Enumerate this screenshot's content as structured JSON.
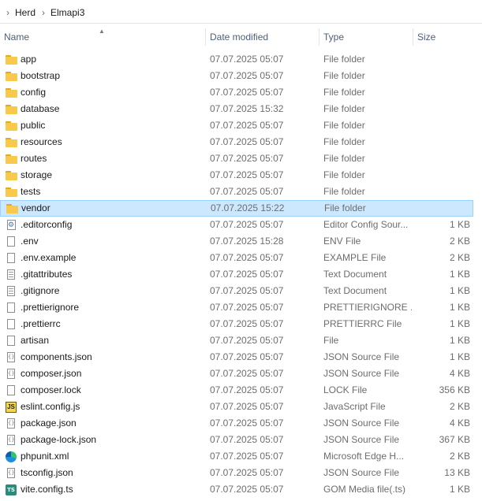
{
  "breadcrumb": {
    "segments": [
      "Herd",
      "Elmapi3"
    ]
  },
  "columns": {
    "name": "Name",
    "date": "Date modified",
    "type": "Type",
    "size": "Size"
  },
  "files": [
    {
      "name": "app",
      "date": "07.07.2025 05:07",
      "type": "File folder",
      "size": "",
      "icon": "folder-icon"
    },
    {
      "name": "bootstrap",
      "date": "07.07.2025 05:07",
      "type": "File folder",
      "size": "",
      "icon": "folder-icon"
    },
    {
      "name": "config",
      "date": "07.07.2025 05:07",
      "type": "File folder",
      "size": "",
      "icon": "folder-icon"
    },
    {
      "name": "database",
      "date": "07.07.2025 15:32",
      "type": "File folder",
      "size": "",
      "icon": "folder-icon"
    },
    {
      "name": "public",
      "date": "07.07.2025 05:07",
      "type": "File folder",
      "size": "",
      "icon": "folder-icon"
    },
    {
      "name": "resources",
      "date": "07.07.2025 05:07",
      "type": "File folder",
      "size": "",
      "icon": "folder-icon"
    },
    {
      "name": "routes",
      "date": "07.07.2025 05:07",
      "type": "File folder",
      "size": "",
      "icon": "folder-icon"
    },
    {
      "name": "storage",
      "date": "07.07.2025 05:07",
      "type": "File folder",
      "size": "",
      "icon": "folder-icon"
    },
    {
      "name": "tests",
      "date": "07.07.2025 05:07",
      "type": "File folder",
      "size": "",
      "icon": "folder-icon"
    },
    {
      "name": "vendor",
      "date": "07.07.2025 15:22",
      "type": "File folder",
      "size": "",
      "icon": "folder-icon",
      "selected": true
    },
    {
      "name": ".editorconfig",
      "date": "07.07.2025 05:07",
      "type": "Editor Config Sour...",
      "size": "1 KB",
      "icon": "gear-file-icon"
    },
    {
      "name": ".env",
      "date": "07.07.2025 15:28",
      "type": "ENV File",
      "size": "2 KB",
      "icon": "file-icon"
    },
    {
      "name": ".env.example",
      "date": "07.07.2025 05:07",
      "type": "EXAMPLE File",
      "size": "2 KB",
      "icon": "file-icon"
    },
    {
      "name": ".gitattributes",
      "date": "07.07.2025 05:07",
      "type": "Text Document",
      "size": "1 KB",
      "icon": "text-file-icon"
    },
    {
      "name": ".gitignore",
      "date": "07.07.2025 05:07",
      "type": "Text Document",
      "size": "1 KB",
      "icon": "text-file-icon"
    },
    {
      "name": ".prettierignore",
      "date": "07.07.2025 05:07",
      "type": "PRETTIERIGNORE ...",
      "size": "1 KB",
      "icon": "file-icon"
    },
    {
      "name": ".prettierrc",
      "date": "07.07.2025 05:07",
      "type": "PRETTIERRC File",
      "size": "1 KB",
      "icon": "file-icon"
    },
    {
      "name": "artisan",
      "date": "07.07.2025 05:07",
      "type": "File",
      "size": "1 KB",
      "icon": "file-icon"
    },
    {
      "name": "components.json",
      "date": "07.07.2025 05:07",
      "type": "JSON Source File",
      "size": "1 KB",
      "icon": "json-file-icon"
    },
    {
      "name": "composer.json",
      "date": "07.07.2025 05:07",
      "type": "JSON Source File",
      "size": "4 KB",
      "icon": "json-file-icon"
    },
    {
      "name": "composer.lock",
      "date": "07.07.2025 05:07",
      "type": "LOCK File",
      "size": "356 KB",
      "icon": "file-icon"
    },
    {
      "name": "eslint.config.js",
      "date": "07.07.2025 05:07",
      "type": "JavaScript File",
      "size": "2 KB",
      "icon": "js-file-icon"
    },
    {
      "name": "package.json",
      "date": "07.07.2025 05:07",
      "type": "JSON Source File",
      "size": "4 KB",
      "icon": "json-file-icon"
    },
    {
      "name": "package-lock.json",
      "date": "07.07.2025 05:07",
      "type": "JSON Source File",
      "size": "367 KB",
      "icon": "json-file-icon"
    },
    {
      "name": "phpunit.xml",
      "date": "07.07.2025 05:07",
      "type": "Microsoft Edge H...",
      "size": "2 KB",
      "icon": "edge-icon"
    },
    {
      "name": "tsconfig.json",
      "date": "07.07.2025 05:07",
      "type": "JSON Source File",
      "size": "13 KB",
      "icon": "json-file-icon"
    },
    {
      "name": "vite.config.ts",
      "date": "07.07.2025 05:07",
      "type": "GOM Media file(.ts)",
      "size": "1 KB",
      "icon": "ts-file-icon"
    }
  ]
}
